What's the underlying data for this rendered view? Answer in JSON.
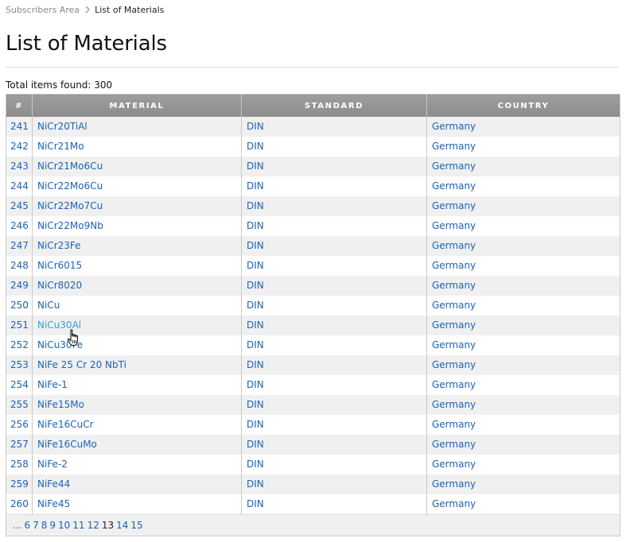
{
  "breadcrumb": {
    "parent": "Subscribers Area",
    "current": "List of Materials"
  },
  "page_title": "List of Materials",
  "total_text": "Total items found: 300",
  "table": {
    "headers": {
      "num": "#",
      "material": "MATERIAL",
      "standard": "STANDARD",
      "country": "COUNTRY"
    },
    "rows": [
      {
        "num": "241",
        "material": "NiCr20TiAl",
        "standard": "DIN",
        "country": "Germany"
      },
      {
        "num": "242",
        "material": "NiCr21Mo",
        "standard": "DIN",
        "country": "Germany"
      },
      {
        "num": "243",
        "material": "NiCr21Mo6Cu",
        "standard": "DIN",
        "country": "Germany"
      },
      {
        "num": "244",
        "material": "NiCr22Mo6Cu",
        "standard": "DIN",
        "country": "Germany"
      },
      {
        "num": "245",
        "material": "NiCr22Mo7Cu",
        "standard": "DIN",
        "country": "Germany"
      },
      {
        "num": "246",
        "material": "NiCr22Mo9Nb",
        "standard": "DIN",
        "country": "Germany"
      },
      {
        "num": "247",
        "material": "NiCr23Fe",
        "standard": "DIN",
        "country": "Germany"
      },
      {
        "num": "248",
        "material": "NiCr6015",
        "standard": "DIN",
        "country": "Germany"
      },
      {
        "num": "249",
        "material": "NiCr8020",
        "standard": "DIN",
        "country": "Germany"
      },
      {
        "num": "250",
        "material": "NiCu",
        "standard": "DIN",
        "country": "Germany"
      },
      {
        "num": "251",
        "material": "NiCu30Al",
        "standard": "DIN",
        "country": "Germany"
      },
      {
        "num": "252",
        "material": "NiCu30Fe",
        "standard": "DIN",
        "country": "Germany"
      },
      {
        "num": "253",
        "material": "NiFe 25 Cr 20 NbTi",
        "standard": "DIN",
        "country": "Germany"
      },
      {
        "num": "254",
        "material": "NiFe-1",
        "standard": "DIN",
        "country": "Germany"
      },
      {
        "num": "255",
        "material": "NiFe15Mo",
        "standard": "DIN",
        "country": "Germany"
      },
      {
        "num": "256",
        "material": "NiFe16CuCr",
        "standard": "DIN",
        "country": "Germany"
      },
      {
        "num": "257",
        "material": "NiFe16CuMo",
        "standard": "DIN",
        "country": "Germany"
      },
      {
        "num": "258",
        "material": "NiFe-2",
        "standard": "DIN",
        "country": "Germany"
      },
      {
        "num": "259",
        "material": "NiFe44",
        "standard": "DIN",
        "country": "Germany"
      },
      {
        "num": "260",
        "material": "NiFe45",
        "standard": "DIN",
        "country": "Germany"
      }
    ]
  },
  "pagination": {
    "ellipsis": "...",
    "pages": [
      "6",
      "7",
      "8",
      "9",
      "10",
      "11",
      "12",
      "13",
      "14",
      "15"
    ],
    "current": "13"
  },
  "icons": {
    "breadcrumb_separator": "chevron-right-icon",
    "cursor": "hand-pointer-icon"
  },
  "colors": {
    "link": "#1a63b8",
    "link_hover": "#33a0dd",
    "header_bg": "#959595",
    "row_alt": "#f0f0f0"
  }
}
